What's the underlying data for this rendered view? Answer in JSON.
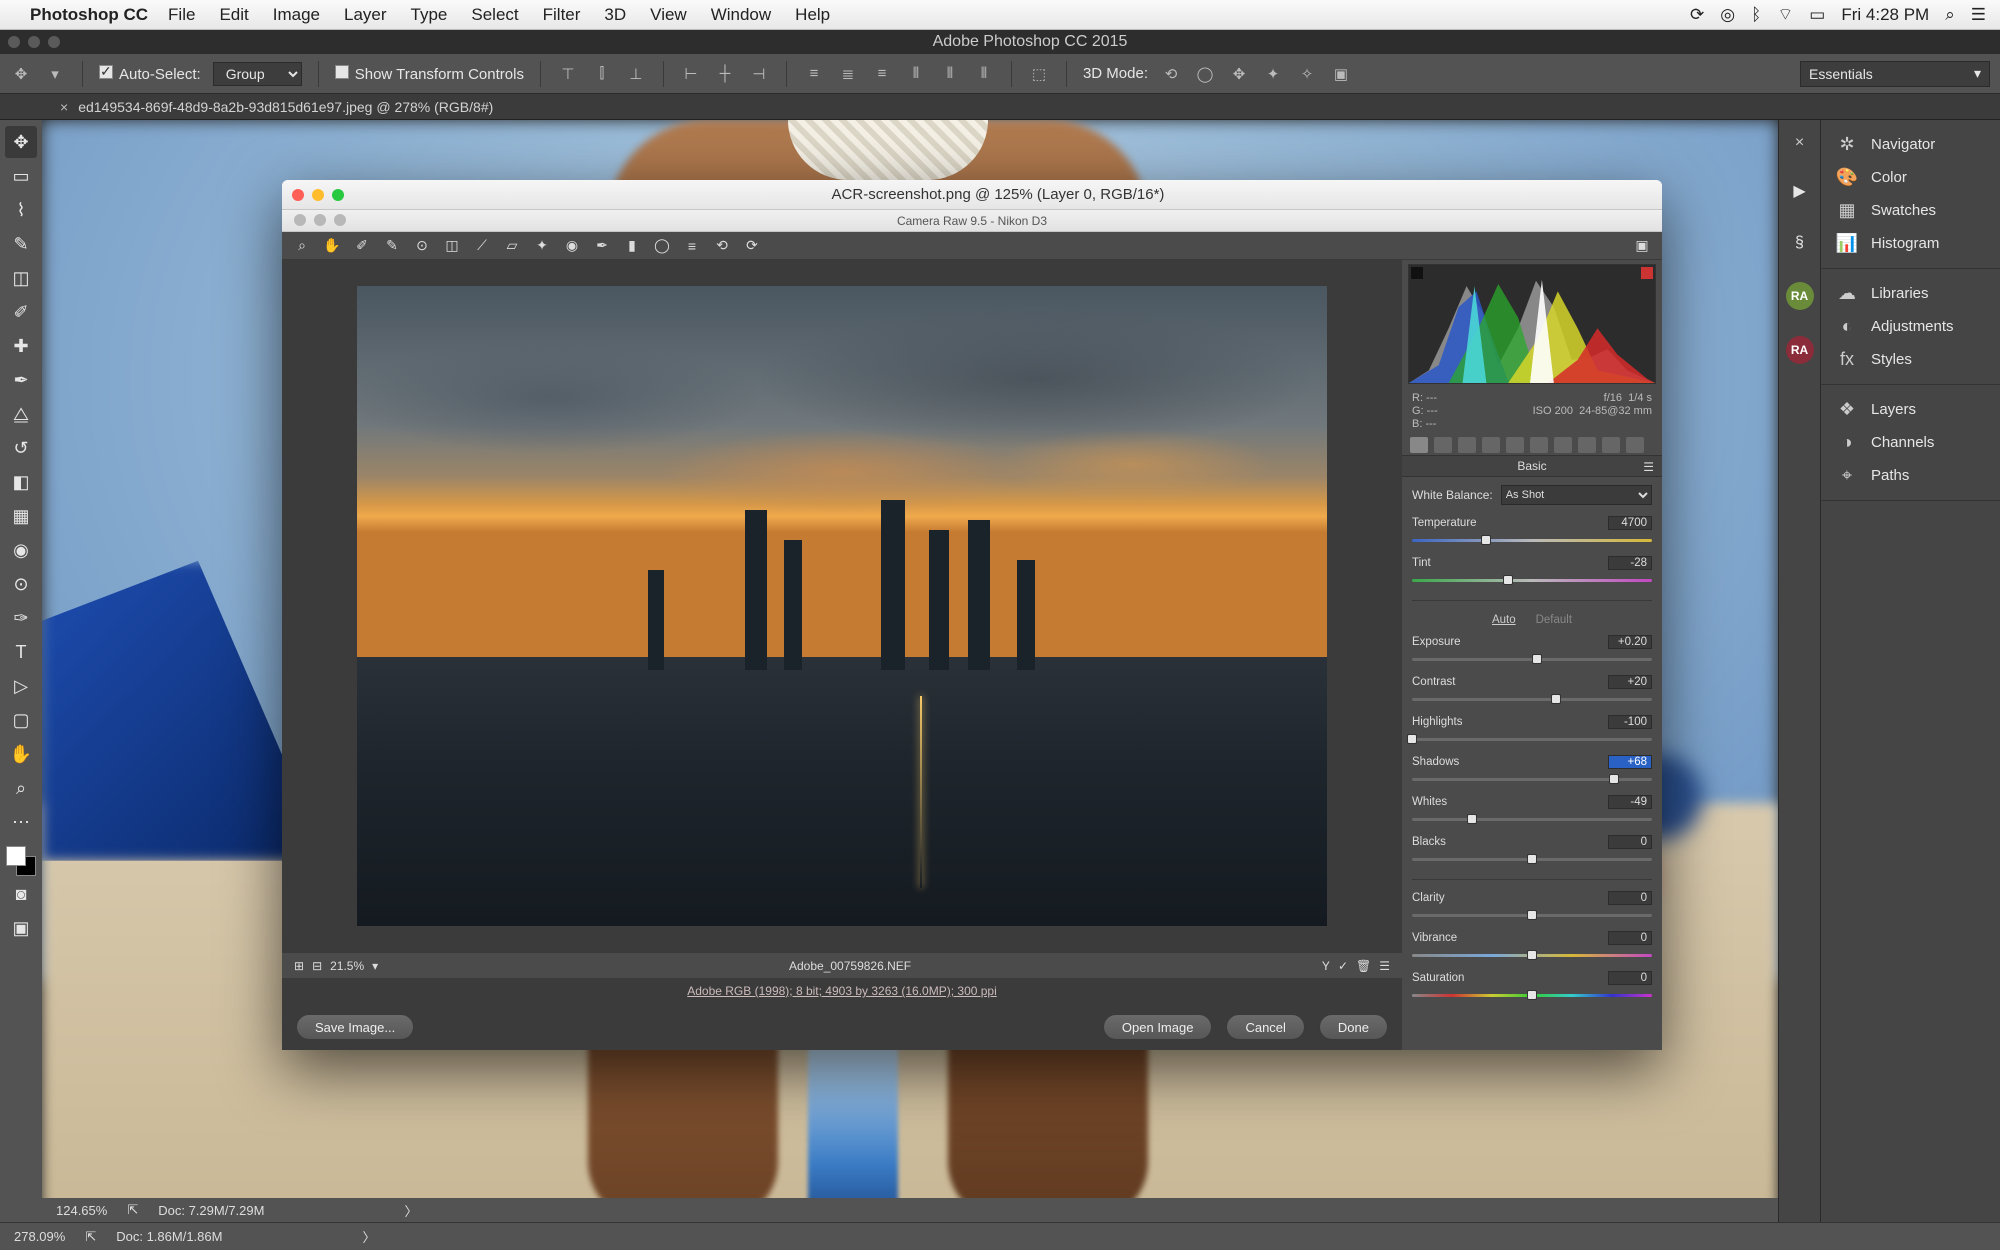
{
  "menubar": {
    "app": "Photoshop CC",
    "items": [
      "File",
      "Edit",
      "Image",
      "Layer",
      "Type",
      "Select",
      "Filter",
      "3D",
      "View",
      "Window",
      "Help"
    ],
    "clock": "Fri 4:28 PM"
  },
  "ps_window_title": "Adobe Photoshop CC 2015",
  "optbar": {
    "auto_select": "Auto-Select:",
    "group": "Group",
    "show_transform": "Show Transform Controls",
    "mode3d": "3D Mode:",
    "workspace": "Essentials"
  },
  "doc_tab": "ed149534-869f-48d9-8a2b-93d815d61e97.jpeg @ 278% (RGB/8#)",
  "panels": {
    "group1": [
      "Navigator",
      "Color",
      "Swatches",
      "Histogram"
    ],
    "group2": [
      "Libraries",
      "Adjustments",
      "Styles"
    ],
    "group3": [
      "Layers",
      "Channels",
      "Paths"
    ]
  },
  "status_inner": {
    "zoom": "124.65%",
    "doc": "Doc: 7.29M/7.29M"
  },
  "status_outer": {
    "zoom": "278.09%",
    "doc": "Doc: 1.86M/1.86M"
  },
  "acr": {
    "title": "ACR-screenshot.png @ 125% (Layer 0, RGB/16*)",
    "subtitle": "Camera Raw 9.5  -  Nikon D3",
    "filmstrip_zoom": "21.5%",
    "filename": "Adobe_00759826.NEF",
    "profile_info": "Adobe RGB (1998); 8 bit; 4903 by 3263 (16.0MP); 300 ppi",
    "btn_save": "Save Image...",
    "btn_open": "Open Image",
    "btn_cancel": "Cancel",
    "btn_done": "Done",
    "readout": {
      "r": "R:   ---",
      "g": "G:   ---",
      "b": "B:   ---",
      "aperture": "f/16",
      "shutter": "1/4 s",
      "iso": "ISO 200",
      "lens": "24-85@32 mm"
    },
    "panel_title": "Basic",
    "wb_label": "White Balance:",
    "wb_value": "As Shot",
    "auto": "Auto",
    "default": "Default",
    "sliders": {
      "temperature": {
        "label": "Temperature",
        "value": "4700",
        "pos": 31
      },
      "tint": {
        "label": "Tint",
        "value": "-28",
        "pos": 40
      },
      "exposure": {
        "label": "Exposure",
        "value": "+0.20",
        "pos": 52
      },
      "contrast": {
        "label": "Contrast",
        "value": "+20",
        "pos": 60
      },
      "highlights": {
        "label": "Highlights",
        "value": "-100",
        "pos": 0
      },
      "shadows": {
        "label": "Shadows",
        "value": "+68",
        "pos": 84,
        "hl": true
      },
      "whites": {
        "label": "Whites",
        "value": "-49",
        "pos": 25
      },
      "blacks": {
        "label": "Blacks",
        "value": "0",
        "pos": 50
      },
      "clarity": {
        "label": "Clarity",
        "value": "0",
        "pos": 50
      },
      "vibrance": {
        "label": "Vibrance",
        "value": "0",
        "pos": 50
      },
      "saturation": {
        "label": "Saturation",
        "value": "0",
        "pos": 50
      }
    }
  },
  "collapsed_badges": [
    "RA",
    "RA"
  ]
}
